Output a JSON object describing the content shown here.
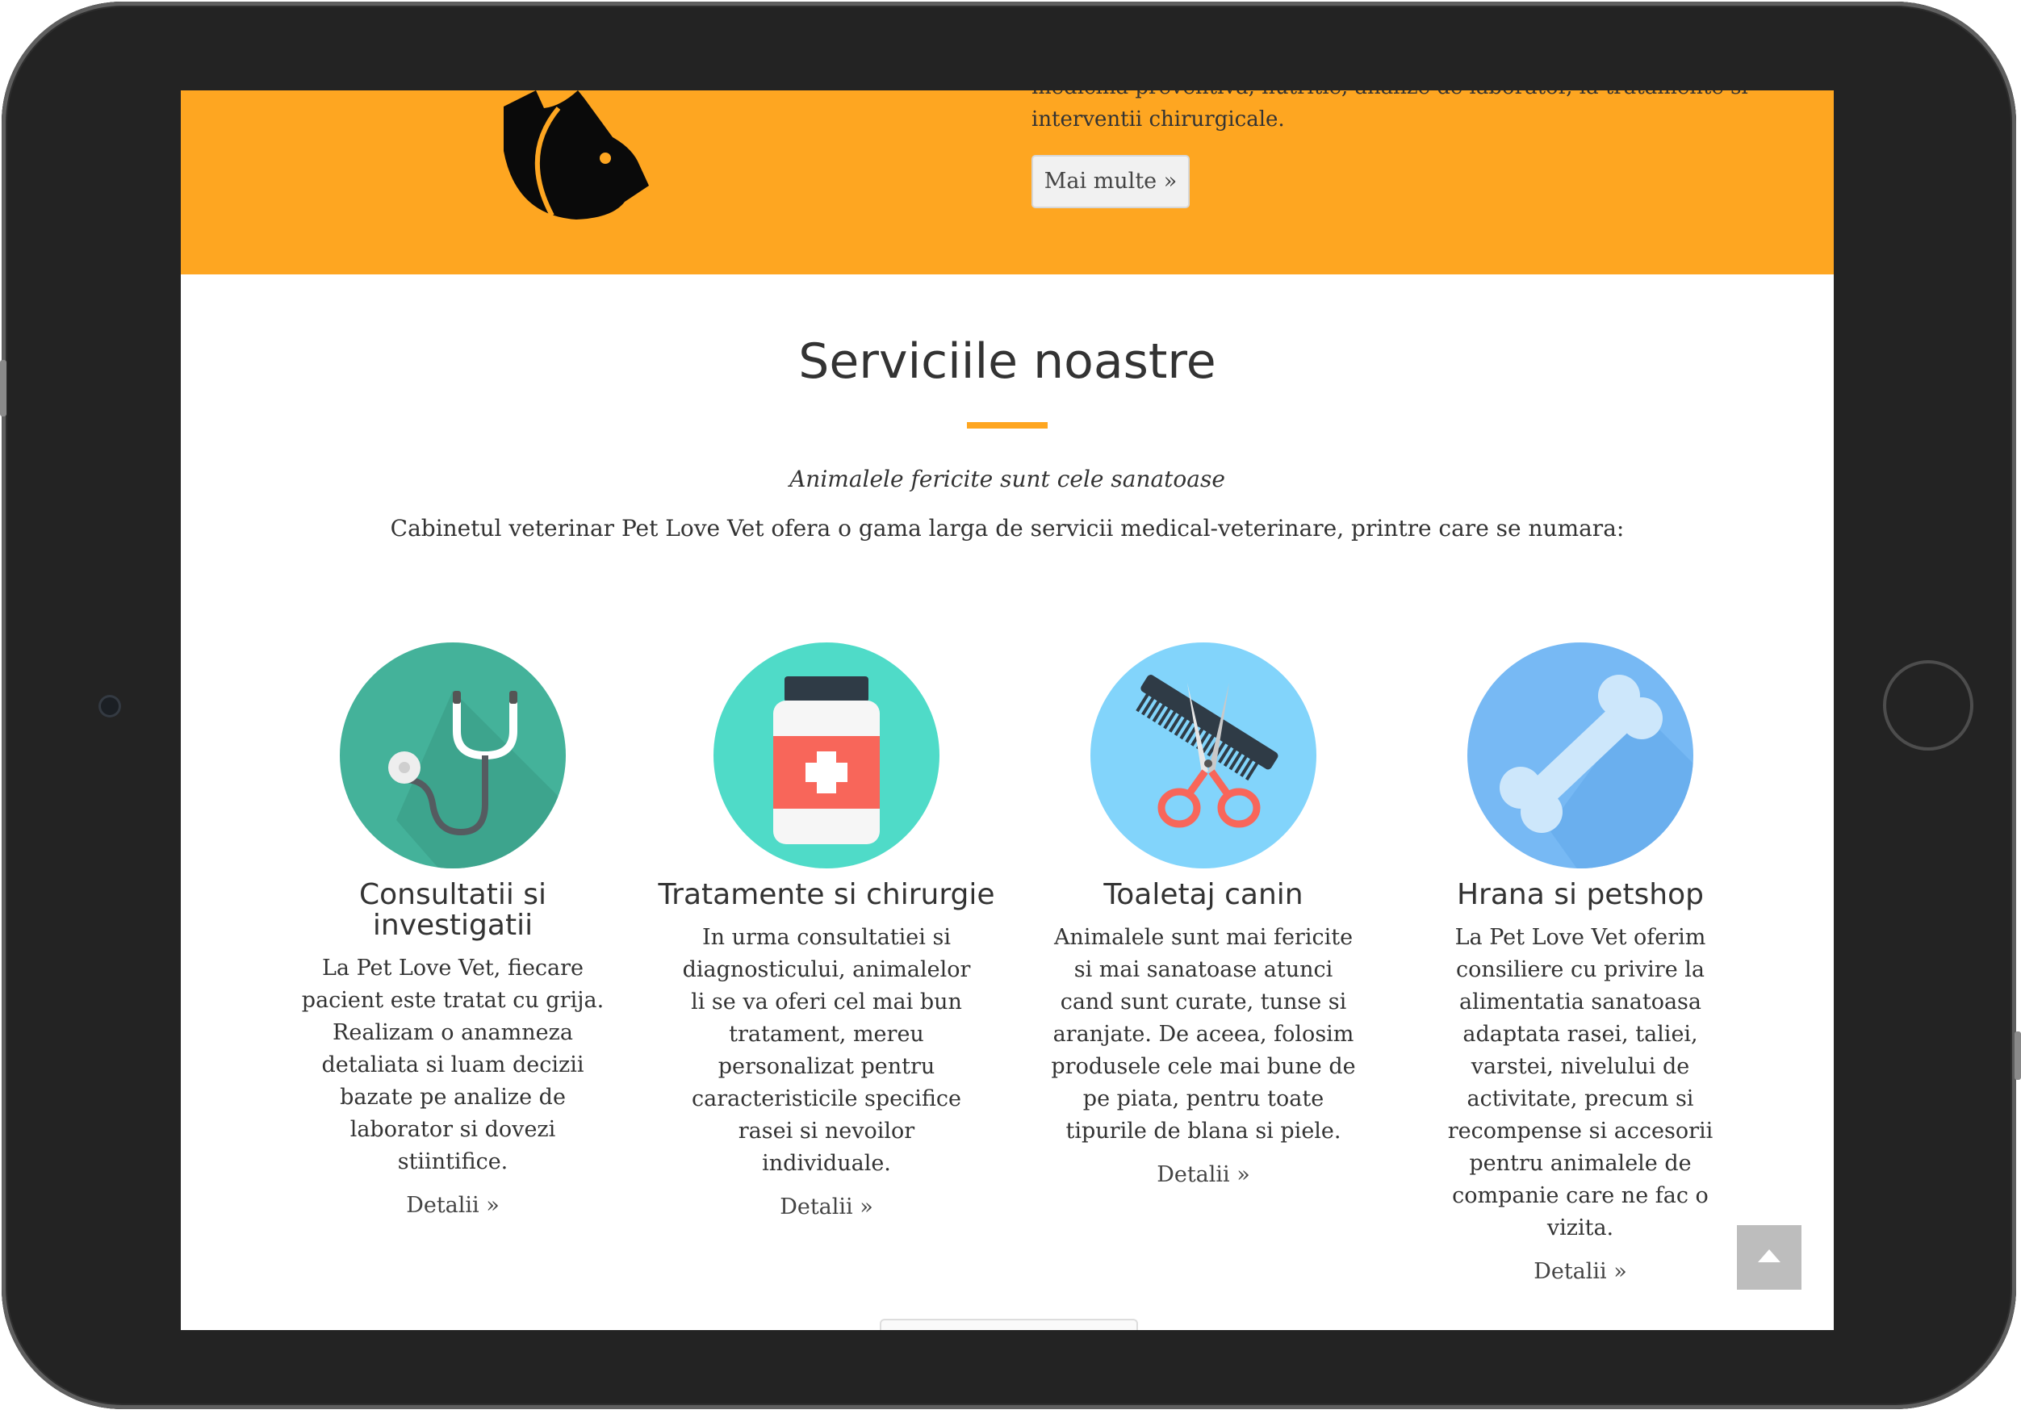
{
  "hero": {
    "text_partial": "medicina preventiva, nutritie, analize de laborator, la tratamente si",
    "text_line2": "interventii chirurgicale.",
    "more_button": "Mai multe »"
  },
  "services_section": {
    "title": "Serviciile noastre",
    "tagline": "Animalele fericite sunt cele sanatoase",
    "intro": "Cabinetul veterinar Pet Love Vet ofera o gama larga de servicii medical-veterinare, printre care se numara:",
    "items": [
      {
        "title": "Consultatii si investigatii",
        "text": "La Pet Love Vet, fiecare pacient este tratat cu grija. Realizam o anamneza detaliata si luam decizii bazate pe analize de laborator si dovezi stiintifice.",
        "link": "Detalii »",
        "icon": "stethoscope-icon",
        "color": "#44b29a"
      },
      {
        "title": "Tratamente si chirurgie",
        "text": "In urma consultatiei si diagnosticului, animalelor li se va oferi cel mai bun tratament, mereu personalizat pentru caracteristicile specifice rasei si nevoilor individuale.",
        "link": "Detalii »",
        "icon": "medicine-bottle-icon",
        "color": "#4fdbc8"
      },
      {
        "title": "Toaletaj canin",
        "text": "Animalele sunt mai fericite si mai sanatoase atunci cand sunt curate, tunse si aranjate. De aceea, folosim produsele cele mai bune de pe piata, pentru toate tipurile de blana si piele.",
        "link": "Detalii »",
        "icon": "comb-scissors-icon",
        "color": "#82d4fb"
      },
      {
        "title": "Hrana si petshop",
        "text": "La Pet Love Vet oferim consiliere cu privire la alimentatia sanatoasa adaptata rasei, taliei, varstei, nivelului de activitate, precum si recompense si accesorii pentru animalele de companie care ne fac o vizita.",
        "link": "Detalii »",
        "icon": "bone-icon",
        "color": "#77b9f4"
      }
    ]
  },
  "colors": {
    "accent": "#fea621",
    "device_frame": "#232323",
    "scroll_top_button": "#bdbdbd"
  }
}
